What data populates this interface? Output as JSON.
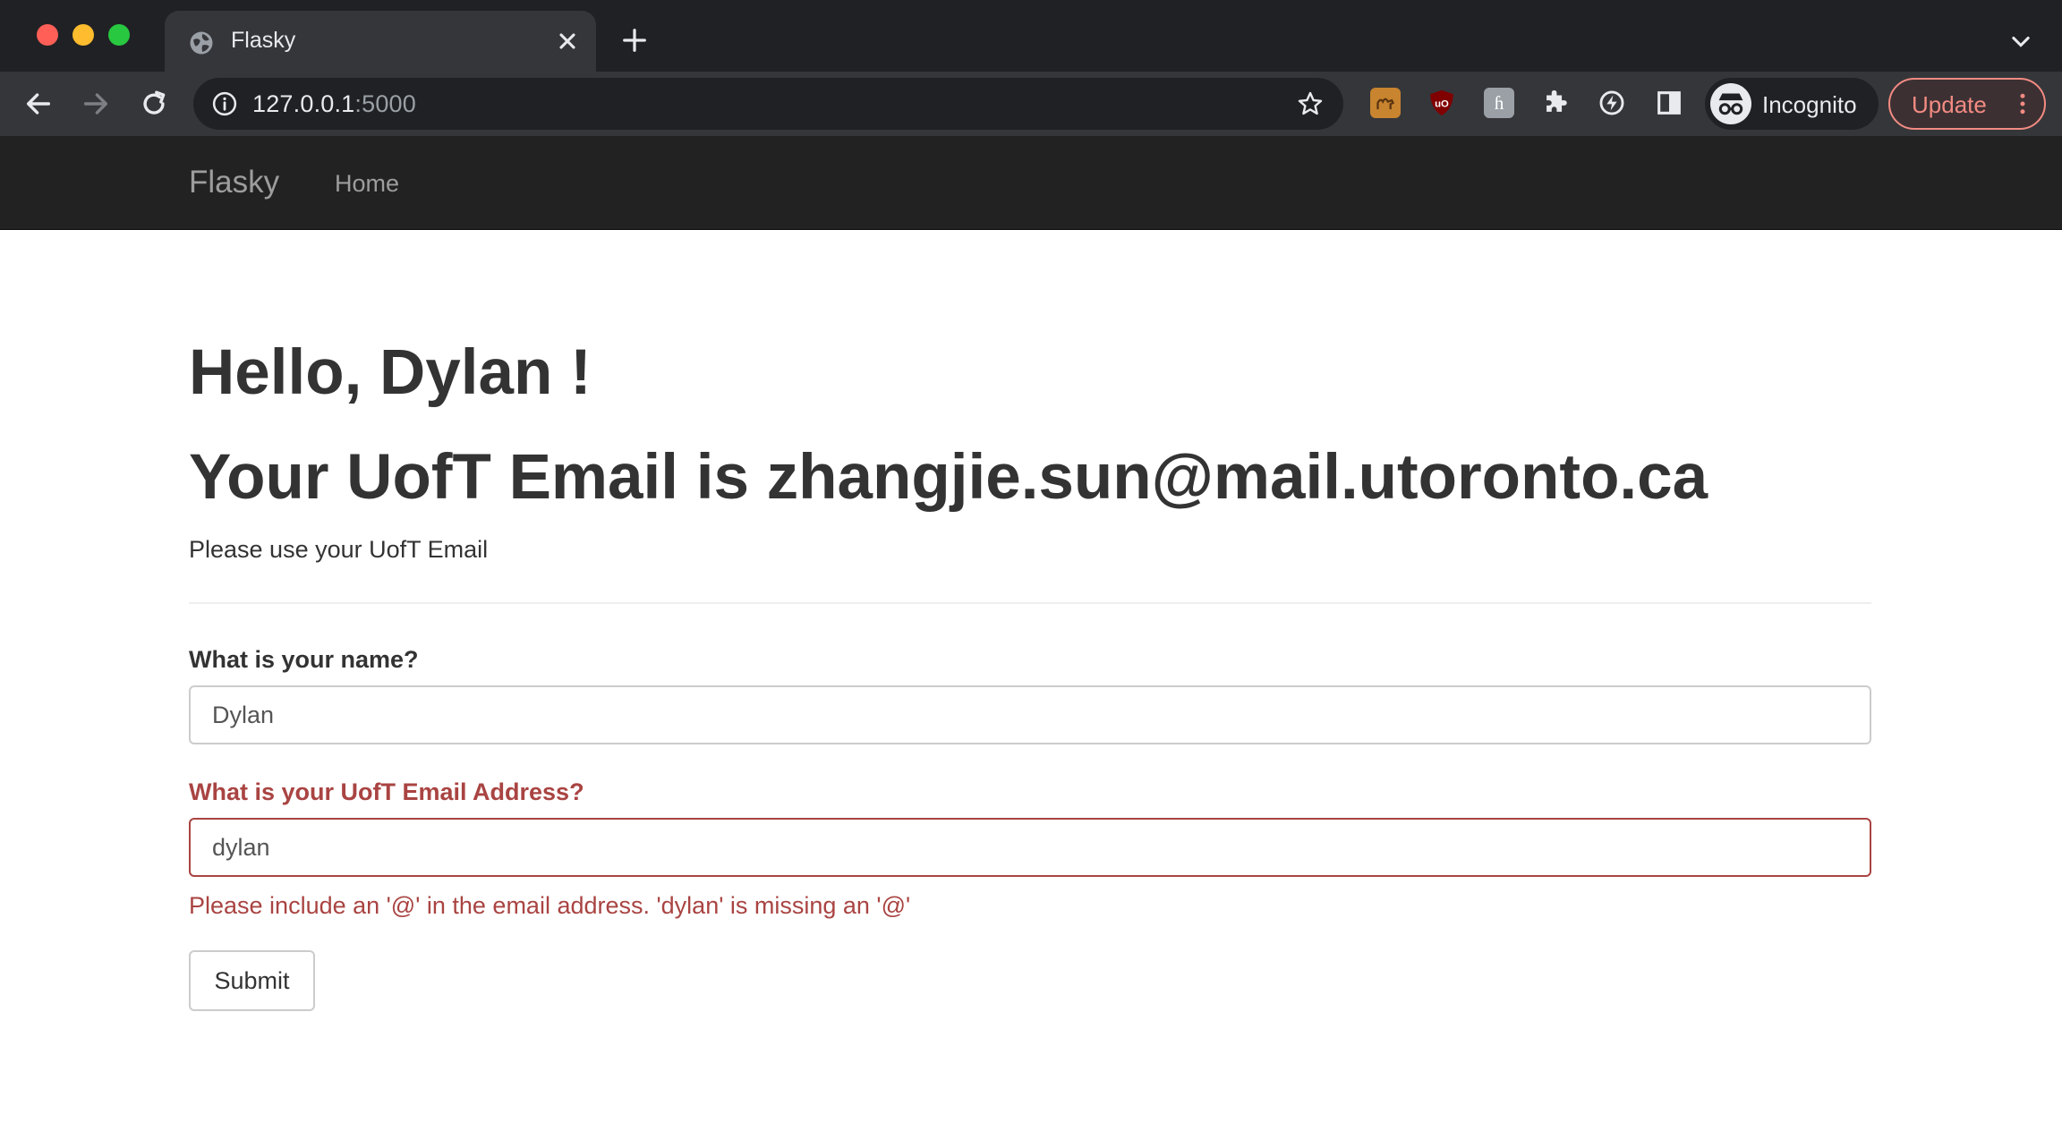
{
  "browser": {
    "tab": {
      "title": "Flasky"
    },
    "address": {
      "host": "127.0.0.1",
      "port": ":5000"
    },
    "profile": {
      "label": "Incognito"
    },
    "update": {
      "label": "Update"
    },
    "colors": {
      "tab_strip": "#202124",
      "toolbar": "#35363a",
      "update_accent": "#f28b82"
    }
  },
  "navbar": {
    "brand": "Flasky",
    "links": [
      "Home"
    ]
  },
  "main": {
    "greeting": "Hello, Dylan !",
    "email_heading": "Your UofT Email is zhangjie.sun@mail.utoronto.ca",
    "notice": "Please use your UofT Email",
    "form": {
      "name_label": "What is your name?",
      "name_value": "Dylan",
      "email_label": "What is your UofT Email Address?",
      "email_value": "dylan",
      "email_error": "Please include an '@' in the email address. 'dylan' is missing an '@'",
      "submit_label": "Submit"
    }
  },
  "colors": {
    "navbar_bg": "#222222",
    "error": "#a94442",
    "text": "#333333"
  }
}
